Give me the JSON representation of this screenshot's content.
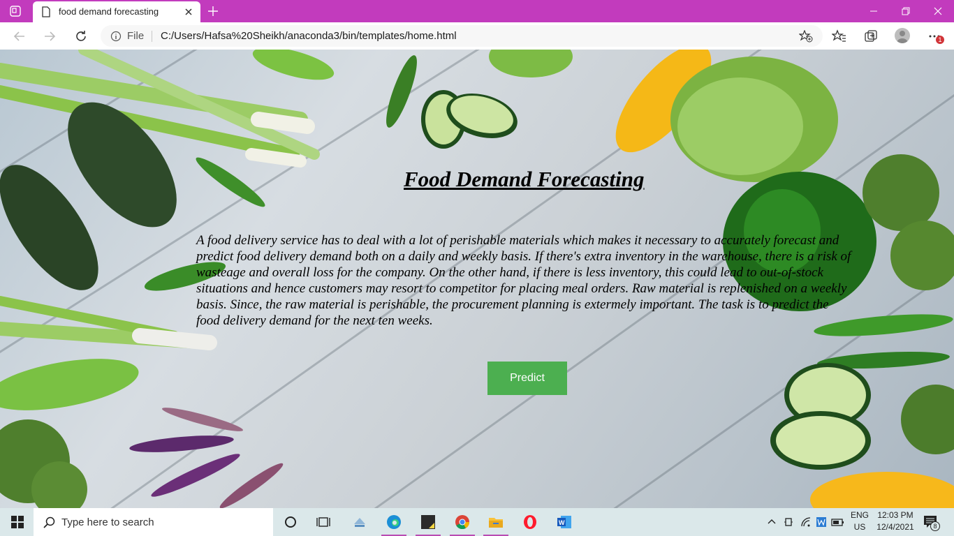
{
  "browser": {
    "tab_title": "food demand forecasting",
    "omnibox_scheme": "File",
    "url": "C:/Users/Hafsa%20Sheikh/anaconda3/bin/templates/home.html",
    "notification_count": "1",
    "accent_color": "#c23bbd"
  },
  "page": {
    "title": "Food Demand Forecasting",
    "description": "A food delivery service has to deal with a lot of perishable materials which makes it necessary to accurately forecast and predict food delivery demand both on a daily and weekly basis. If there's extra inventory in the warehouse, there is a risk of wasteage and overall loss for the company. On the other hand, if there is less inventory, this could lead to out-of-stock situations and hence customers may resort to competitor for placing meal orders. Raw material is replenished on a weekly basis. Since, the raw material is perishable, the procurement planning is extermely important. The task is to predict the food delivery demand for the next ten weeks.",
    "predict_label": "Predict",
    "button_color": "#4caf50"
  },
  "taskbar": {
    "search_placeholder": "Type here to search",
    "apps": [
      "task-view",
      "file-explorer",
      "edge",
      "sticky-notes",
      "chrome",
      "folder",
      "opera",
      "word"
    ],
    "language_line1": "ENG",
    "language_line2": "US",
    "time": "12:03 PM",
    "date": "12/4/2021",
    "action_center_count": "8"
  }
}
